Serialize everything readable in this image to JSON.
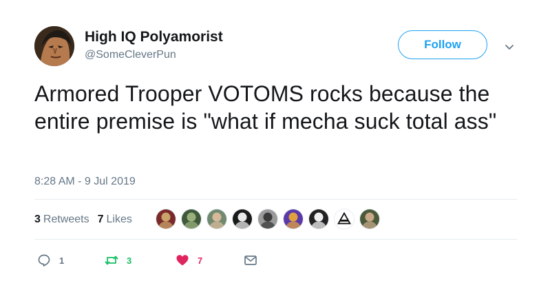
{
  "author": {
    "display_name": "High IQ Polyamorist",
    "handle": "@SomeCleverPun"
  },
  "follow_label": "Follow",
  "tweet_text": "Armored Trooper VOTOMS rocks because the entire premise is \"what if mecha suck total ass\"",
  "timestamp": "8:28 AM - 9 Jul 2019",
  "stats": {
    "retweets_count": "3",
    "retweets_label": "Retweets",
    "likes_count": "7",
    "likes_label": "Likes"
  },
  "likers": [
    {
      "icon": "avatar-mech",
      "colors": [
        "#7a2a2a",
        "#caa36a"
      ]
    },
    {
      "icon": "avatar-creature",
      "colors": [
        "#3f5a3a",
        "#9ab07c"
      ]
    },
    {
      "icon": "avatar-glasses-man",
      "colors": [
        "#6f8a6f",
        "#d8b89a"
      ]
    },
    {
      "icon": "avatar-bw-face",
      "colors": [
        "#1a1a1a",
        "#e8e8e8"
      ]
    },
    {
      "icon": "avatar-gray-figure",
      "colors": [
        "#9a9a9a",
        "#3a3a3a"
      ]
    },
    {
      "icon": "avatar-purple-landscape",
      "colors": [
        "#5a3aa8",
        "#e0a040"
      ]
    },
    {
      "icon": "avatar-bw-portrait",
      "colors": [
        "#222222",
        "#f0f0f0"
      ]
    },
    {
      "icon": "avatar-logo-triangle",
      "colors": [
        "#ffffff",
        "#111111"
      ]
    },
    {
      "icon": "avatar-cap-man",
      "colors": [
        "#4a5a3a",
        "#c7a888"
      ]
    }
  ],
  "actions": {
    "reply_count": "1",
    "retweet_count": "3",
    "like_count": "7"
  },
  "colors": {
    "accent": "#1da1f2",
    "secondary_text": "#657786",
    "retweet_green": "#17bf63",
    "like_red": "#e0245e",
    "divider": "#e6ecf0"
  }
}
